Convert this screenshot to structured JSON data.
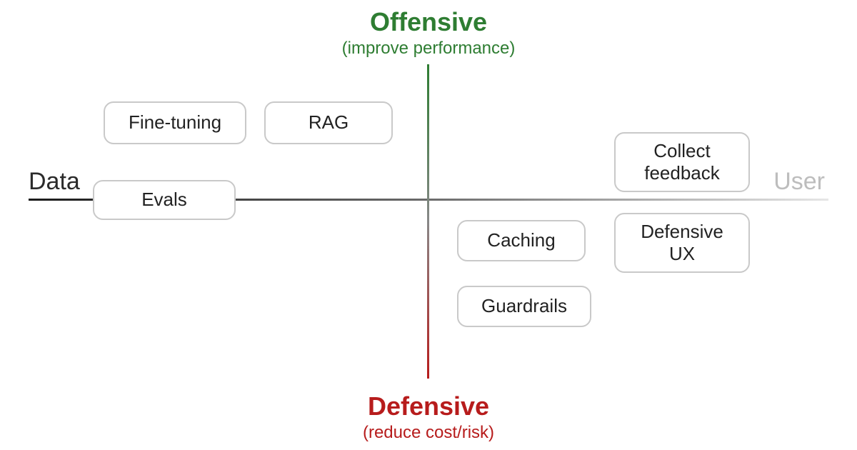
{
  "chart_data": {
    "type": "quadrant",
    "axes": {
      "top": {
        "title": "Offensive",
        "subtitle": "(improve performance)",
        "color": "#2e7d32"
      },
      "bottom": {
        "title": "Defensive",
        "subtitle": "(reduce cost/risk)",
        "color": "#b71c1c"
      },
      "left": {
        "title": "Data",
        "color": "#2b2b2b"
      },
      "right": {
        "title": "User",
        "color": "#bdbdbd"
      }
    },
    "nodes": [
      {
        "id": "fine_tuning",
        "label": "Fine-tuning",
        "quadrant": "data-offensive"
      },
      {
        "id": "rag",
        "label": "RAG",
        "quadrant": "data-offensive"
      },
      {
        "id": "evals",
        "label": "Evals",
        "quadrant": "data-axis"
      },
      {
        "id": "collect_feedback",
        "label": "Collect\nfeedback",
        "quadrant": "user-offensive"
      },
      {
        "id": "caching",
        "label": "Caching",
        "quadrant": "user-defensive"
      },
      {
        "id": "defensive_ux",
        "label": "Defensive\nUX",
        "quadrant": "user-defensive"
      },
      {
        "id": "guardrails",
        "label": "Guardrails",
        "quadrant": "user-defensive"
      }
    ]
  }
}
